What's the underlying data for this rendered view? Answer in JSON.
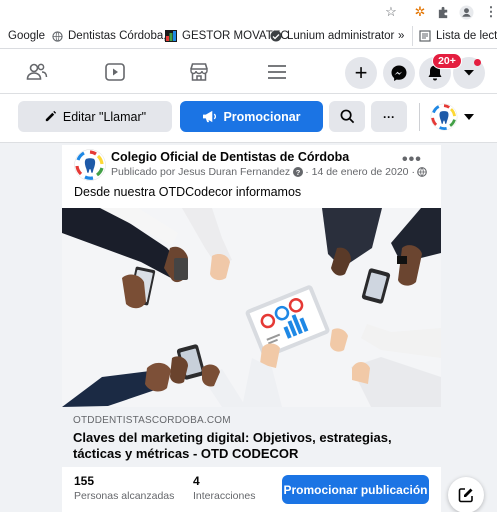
{
  "bookmarks": [
    {
      "label": "Google"
    },
    {
      "label": "Dentistas Córdoba,..."
    },
    {
      "label": "GESTOR MOVATEC"
    },
    {
      "label": "Lunium administrator"
    },
    {
      "label": "»"
    },
    {
      "label": "Lista de lectura"
    }
  ],
  "nav": {
    "notification_count": "20+"
  },
  "actionbar": {
    "edit_label": "Editar \"Llamar\"",
    "promote_label": "Promocionar",
    "more_label": "···"
  },
  "post": {
    "page_name": "Colegio Oficial de Dentistas de Córdoba",
    "byline": "Publicado por Jesus Duran Fernandez",
    "date": "· 14 de enero de 2020 ·",
    "text": "Desde nuestra OTDCodecor informamos",
    "link_domain": "OTDDENTISTASCORDOBA.COM",
    "link_title": "Claves del marketing digital: Objetivos, estrategias, tácticas y métricas - OTD CODECOR",
    "reach_value": "155",
    "reach_label": "Personas alcanzadas",
    "interactions_value": "4",
    "interactions_label": "Interacciones",
    "promote_pub_label": "Promocionar publicación"
  },
  "colors": {
    "brand_blue": "#1b74e4",
    "badge_red": "#e41e3f",
    "bg": "#f0f2f5"
  }
}
